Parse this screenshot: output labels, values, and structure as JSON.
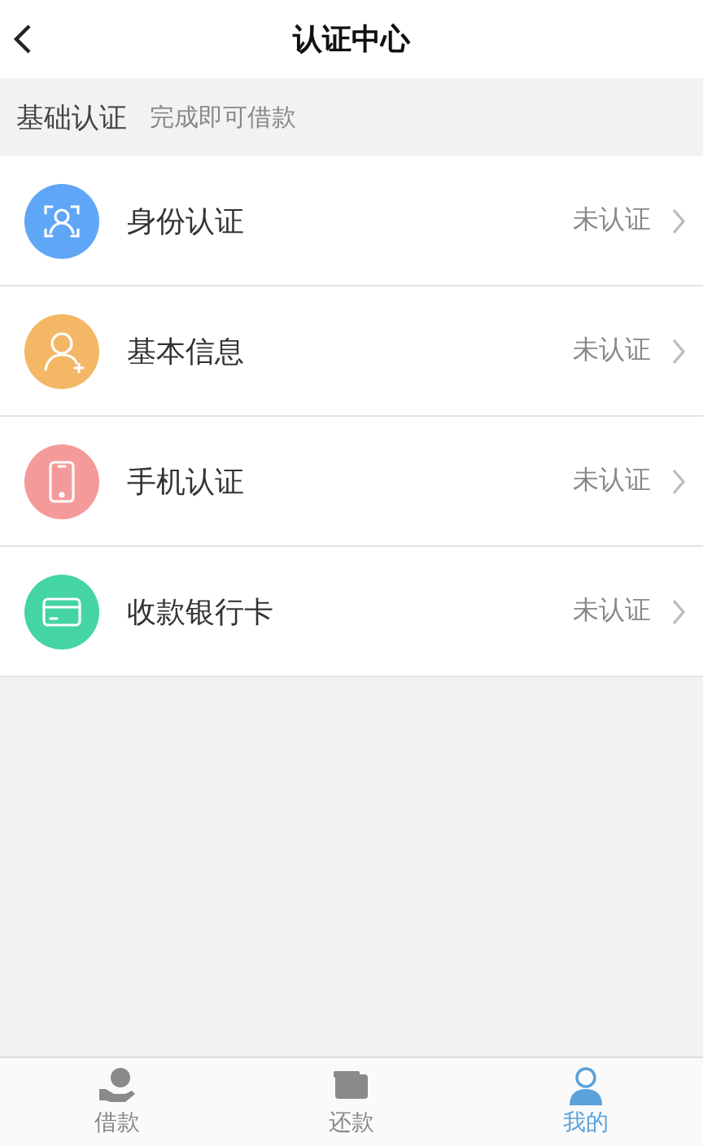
{
  "header": {
    "title": "认证中心"
  },
  "section": {
    "title": "基础认证",
    "hint": "完成即可借款"
  },
  "items": [
    {
      "kind": "id",
      "color": "#5fa6f6",
      "label": "身份认证",
      "status": "未认证"
    },
    {
      "kind": "person",
      "color": "#f3b766",
      "label": "基本信息",
      "status": "未认证"
    },
    {
      "kind": "phone",
      "color": "#f59a9a",
      "label": "手机认证",
      "status": "未认证"
    },
    {
      "kind": "card",
      "color": "#45d4a6",
      "label": "收款银行卡",
      "status": "未认证"
    }
  ],
  "tabs": [
    {
      "kind": "loan",
      "label": "借款",
      "selected": false
    },
    {
      "kind": "repay",
      "label": "还款",
      "selected": false
    },
    {
      "kind": "me",
      "label": "我的",
      "selected": true
    }
  ]
}
